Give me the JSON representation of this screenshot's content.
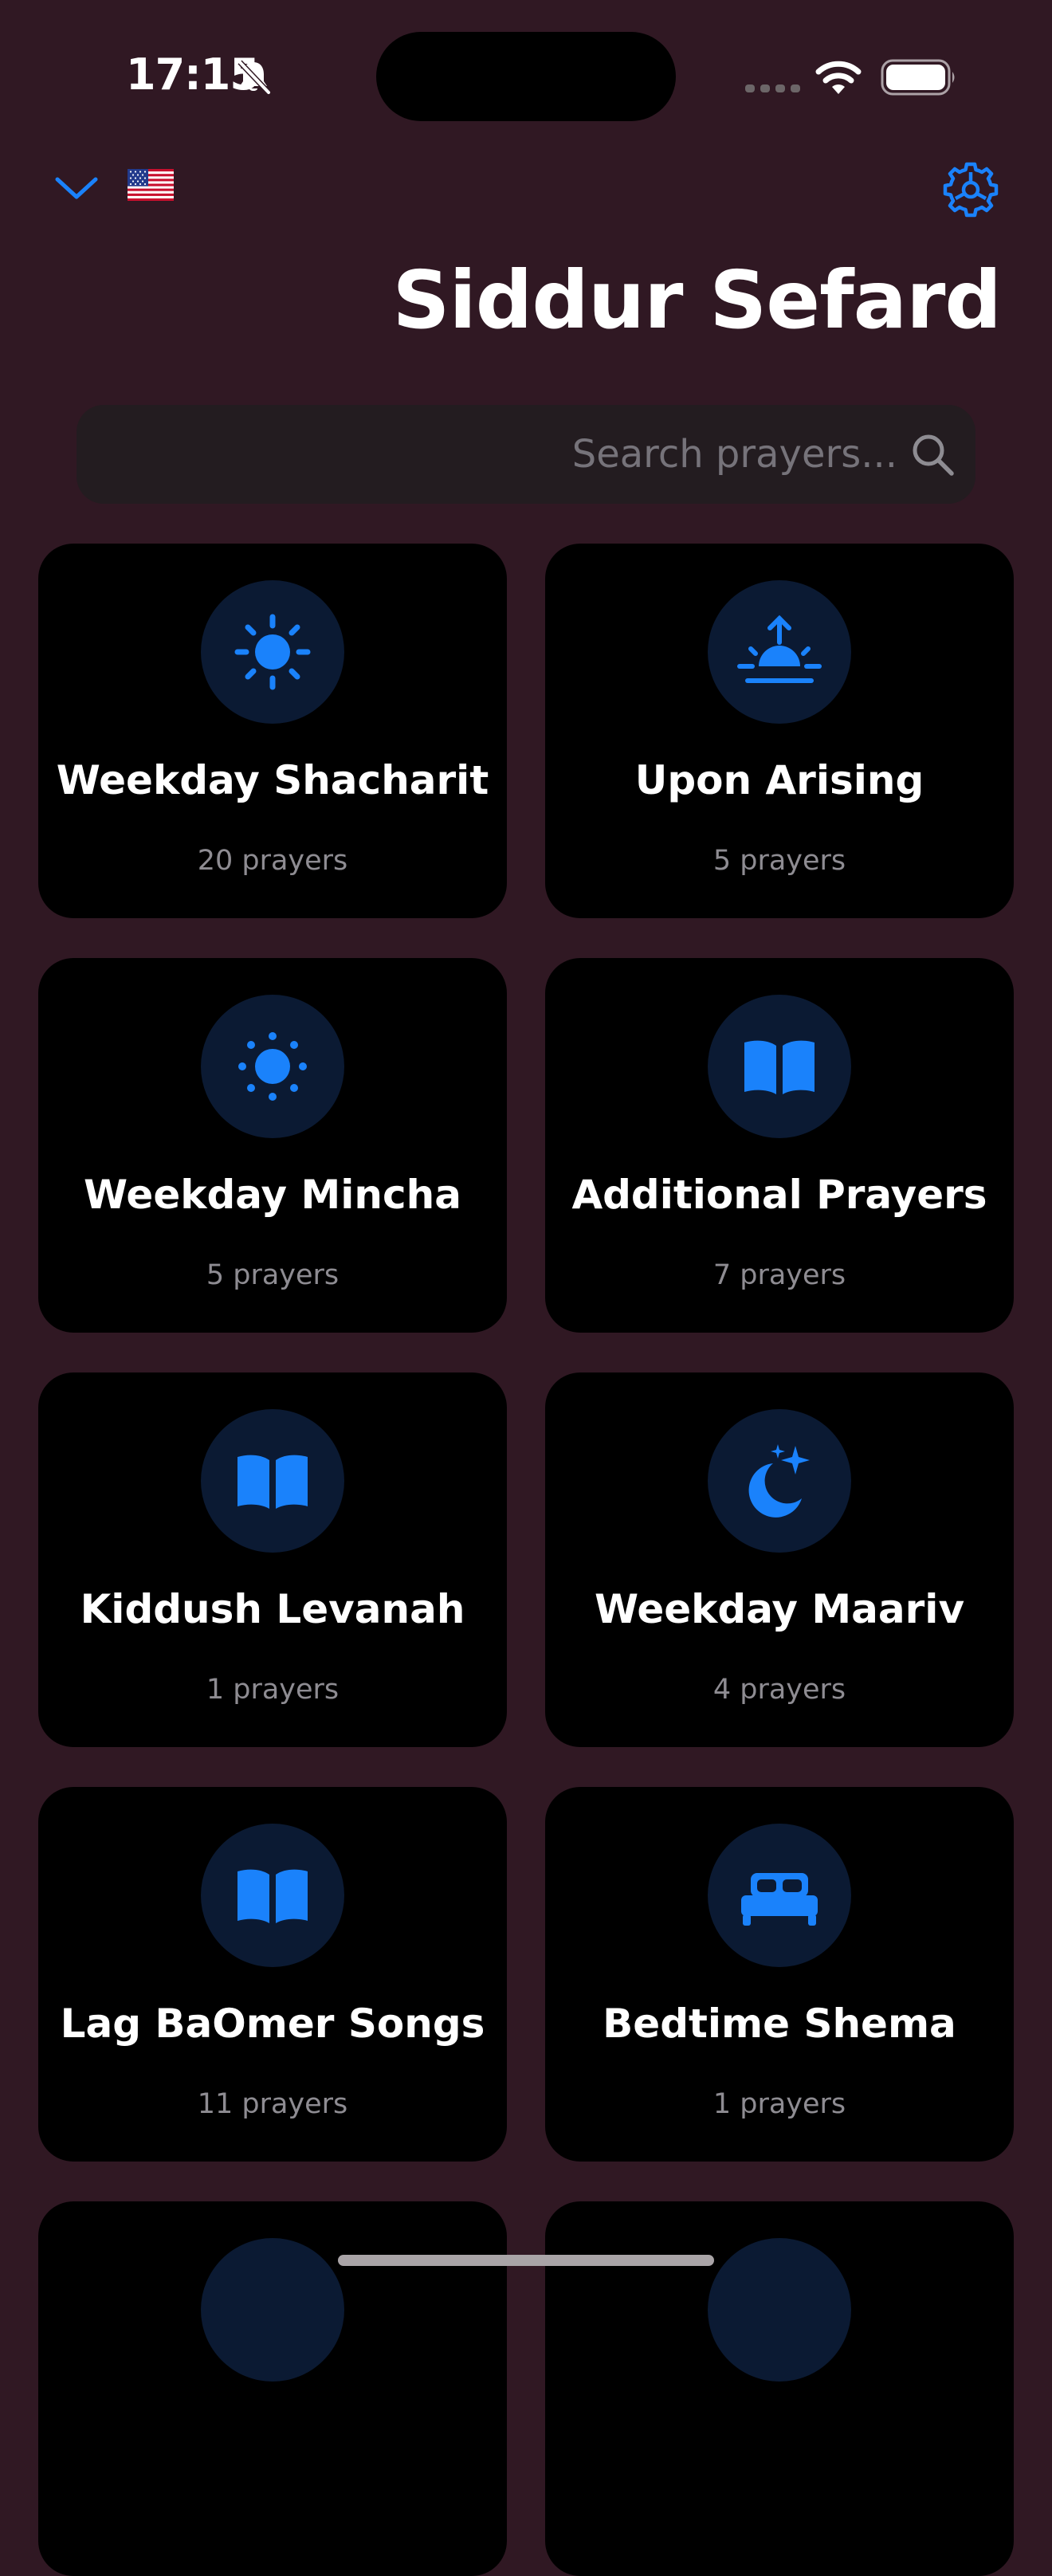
{
  "status_bar": {
    "time": "17:15"
  },
  "header": {
    "flag": "🇺🇸",
    "title": "Siddur Sefard"
  },
  "search": {
    "placeholder": "Search prayers..."
  },
  "colors": {
    "accent": "#1a82fb",
    "background": "#301823",
    "card": "#000000",
    "icon_circle": "#0b1a33"
  },
  "cards": [
    {
      "title": "Weekday Shacharit",
      "count": "20 prayers",
      "icon": "sun-icon"
    },
    {
      "title": "Upon Arising",
      "count": "5 prayers",
      "icon": "sunrise-icon"
    },
    {
      "title": "Weekday Mincha",
      "count": "5 prayers",
      "icon": "sun-dotted-icon"
    },
    {
      "title": "Additional Prayers",
      "count": "7 prayers",
      "icon": "book-icon"
    },
    {
      "title": "Kiddush Levanah",
      "count": "1 prayers",
      "icon": "book-icon"
    },
    {
      "title": "Weekday Maariv",
      "count": "4 prayers",
      "icon": "moon-stars-icon"
    },
    {
      "title": "Lag BaOmer Songs",
      "count": "11 prayers",
      "icon": "book-icon"
    },
    {
      "title": "Bedtime Shema",
      "count": "1 prayers",
      "icon": "bed-icon"
    }
  ]
}
